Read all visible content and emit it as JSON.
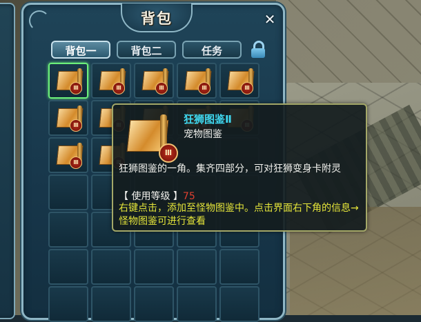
{
  "window": {
    "title": "背包",
    "close_glyph": "✕"
  },
  "tabs": [
    {
      "label": "背包一",
      "active": true
    },
    {
      "label": "背包二",
      "active": false
    },
    {
      "label": "任务",
      "active": false
    }
  ],
  "lock_icon": "lock-icon",
  "inventory": {
    "rows": 7,
    "cols": 5,
    "filled_slots": [
      0,
      1,
      2,
      3,
      4,
      5,
      6,
      7,
      8,
      9,
      10,
      11
    ],
    "selected_slot": 0,
    "item_icon": "scroll-icon",
    "seal_text": "Ⅲ"
  },
  "tooltip": {
    "name": "狂狮图鉴Ⅱ",
    "type": "宠物图鉴",
    "description": "狂狮图鉴的一角。集齐四部分，可对狂狮变身卡附灵",
    "level_label": "【 使用等级 】",
    "level_value": "75",
    "hint": "右键点击，添加至怪物图鉴中。点击界面右下角的信息→怪物图鉴可进行查看",
    "colors": {
      "name": "#3fd8f0",
      "level": "#e04030",
      "hint": "#e6e63a"
    }
  }
}
